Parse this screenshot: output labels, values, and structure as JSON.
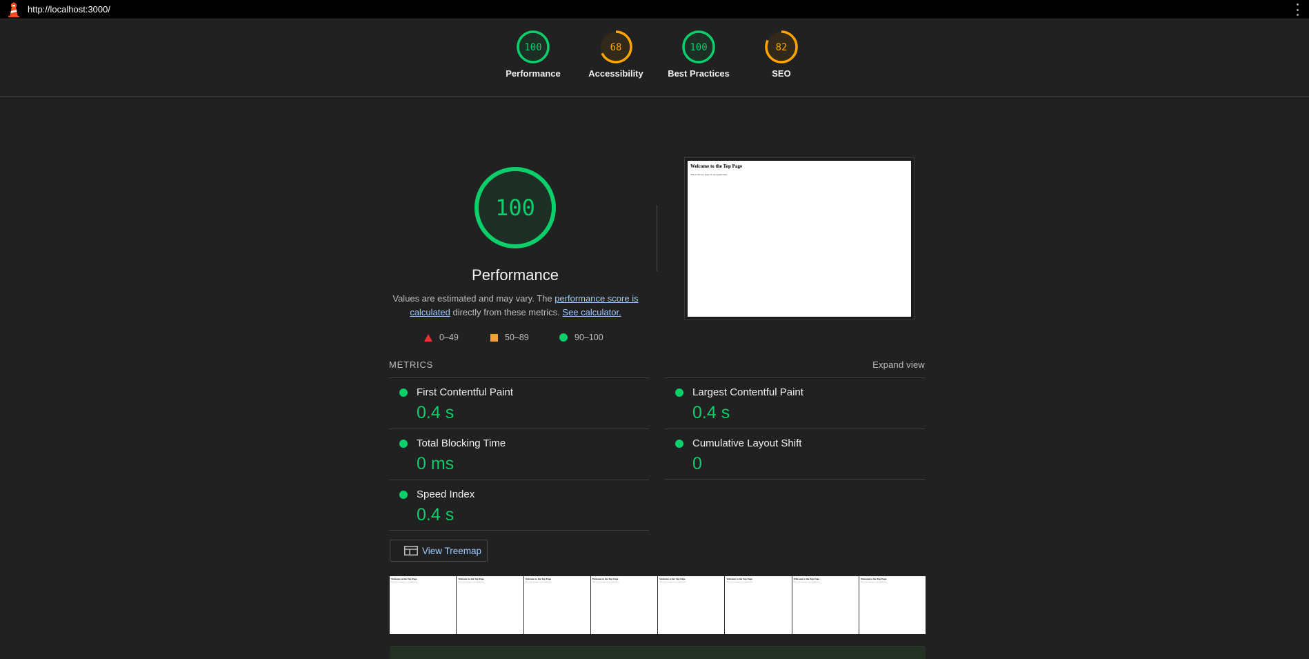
{
  "topbar": {
    "url": "http://localhost:3000/",
    "logo_icon": "lighthouse-icon",
    "menu_icon": "kebab-menu-icon"
  },
  "gauges": [
    {
      "label": "Performance",
      "score": "100",
      "value": 100,
      "color": "#0cce6b"
    },
    {
      "label": "Accessibility",
      "score": "68",
      "value": 68,
      "color": "#ffa400"
    },
    {
      "label": "Best Practices",
      "score": "100",
      "value": 100,
      "color": "#0cce6b"
    },
    {
      "label": "SEO",
      "score": "82",
      "value": 82,
      "color": "#ffa400"
    }
  ],
  "performance": {
    "score": "100",
    "value": 100,
    "color": "#0cce6b",
    "title": "Performance",
    "desc_prefix": "Values are estimated and may vary. The ",
    "desc_link1": "performance score is calculated",
    "desc_mid": " directly from these metrics. ",
    "desc_link2": "See calculator."
  },
  "legend": [
    {
      "range": "0–49",
      "icon": "triangle-fail-icon",
      "color": "#ef2f2f"
    },
    {
      "range": "50–89",
      "icon": "square-average-icon",
      "color": "#f2a23a"
    },
    {
      "range": "90–100",
      "icon": "circle-pass-icon",
      "color": "#0cce6b"
    }
  ],
  "screenshot": {
    "title": "Welcome to the Top Page",
    "text": "This is the top page of our application."
  },
  "metrics": {
    "title": "METRICS",
    "expand_label": "Expand view",
    "items": [
      {
        "name": "First Contentful Paint",
        "value": "0.4 s"
      },
      {
        "name": "Largest Contentful Paint",
        "value": "0.4 s"
      },
      {
        "name": "Total Blocking Time",
        "value": "0 ms"
      },
      {
        "name": "Cumulative Layout Shift",
        "value": "0"
      },
      {
        "name": "Speed Index",
        "value": "0.4 s"
      }
    ]
  },
  "treemap": {
    "label": "View Treemap",
    "icon": "treemap-icon"
  },
  "filmstrip": {
    "frame_title": "Welcome to the Top Page",
    "frame_text": "This is the top page of our application.",
    "frames": 8
  }
}
